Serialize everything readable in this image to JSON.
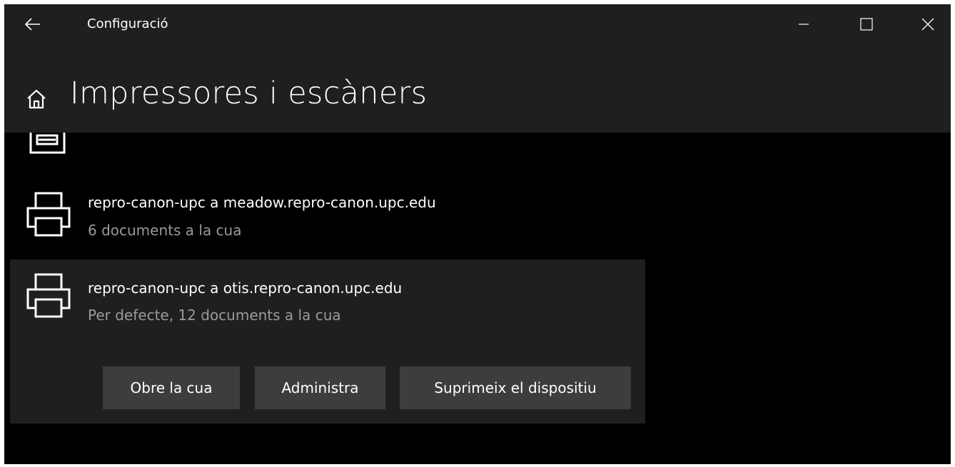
{
  "window": {
    "title": "Configuració",
    "icons": {
      "back": "back-arrow-icon",
      "minimize": "minimize-icon",
      "maximize": "maximize-icon",
      "close": "close-icon"
    }
  },
  "header": {
    "title": "Impressores i escàners",
    "icon": "home-icon"
  },
  "printers": [
    {
      "name": "repro-canon-upc a meadow.repro-canon.upc.edu",
      "status": "6 documents a la cua",
      "icon": "printer-icon"
    },
    {
      "name": "repro-canon-upc a otis.repro-canon.upc.edu",
      "status": "Per defecte, 12 documents a la cua",
      "icon": "printer-icon",
      "selected": true
    }
  ],
  "actions": {
    "open_queue": "Obre la cua",
    "manage": "Administra",
    "remove": "Suprimeix el dispositiu"
  },
  "colors": {
    "chrome": "#1f1f1f",
    "background": "#000000",
    "button": "#3d3d3d",
    "secondary_text": "#9a9a9a"
  }
}
